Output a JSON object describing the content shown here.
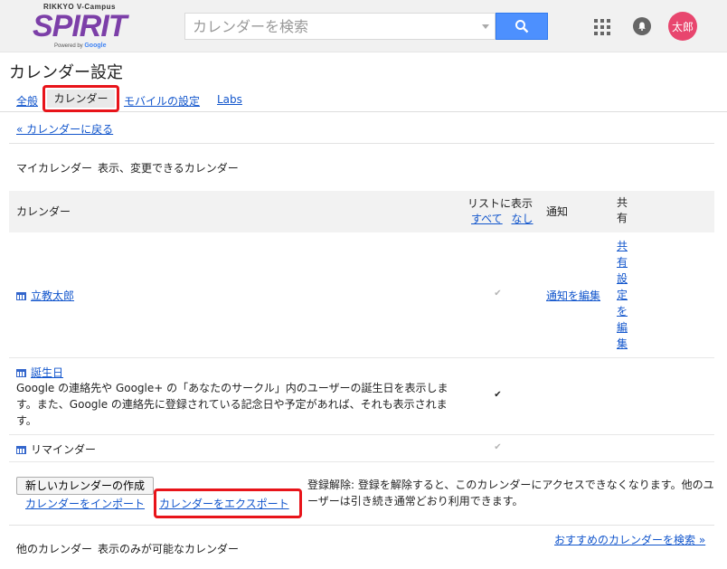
{
  "header": {
    "logo_top": "RIKKYO V-Campus",
    "logo_word": "SPIRIT",
    "logo_powered": "Powered by",
    "logo_google": "Google",
    "search_placeholder": "カレンダーを検索",
    "avatar_text": "太郎"
  },
  "page": {
    "title": "カレンダー設定",
    "tabs": [
      "全般",
      "カレンダー",
      "モバイルの設定",
      "Labs"
    ],
    "back_link": "« カレンダーに戻る"
  },
  "my_calendars": {
    "title": "マイカレンダー",
    "desc": "表示、変更できるカレンダー",
    "columns": {
      "calendar": "カレンダー",
      "show_in_list": "リストに表示",
      "all": "すべて",
      "none": "なし",
      "notify": "通知",
      "share": "共有"
    },
    "rows": [
      {
        "name": "立教太郎",
        "checked": true,
        "enabled": false,
        "notify": "通知を編集",
        "share": "共有設定を編集"
      },
      {
        "name": "誕生日",
        "desc": "Google の連絡先や Google+ の「あなたのサークル」内のユーザーの誕生日を表示します。また、Google の連絡先に登録されている記念日や予定があれば、それも表示されます。",
        "checked": true,
        "enabled": true
      },
      {
        "name": "リマインダー",
        "checked": true,
        "enabled": false
      }
    ],
    "buttons": {
      "create": "新しいカレンダーの作成",
      "import": "カレンダーをインポート",
      "export": "カレンダーをエクスポート"
    },
    "unsubscribe_note": "登録解除: 登録を解除すると、このカレンダーにアクセスできなくなります。他のユーザーは引き続き通常どおり利用できます。"
  },
  "other_calendars": {
    "title": "他のカレンダー",
    "desc": "表示のみが可能なカレンダー",
    "browse_link": "おすすめのカレンダーを検索 »"
  },
  "colors": {
    "brand": "#7c3fa8",
    "search_button": "#4d90fe",
    "avatar": "#e8466e",
    "highlight": "#e8141a",
    "link": "#1155cc"
  }
}
